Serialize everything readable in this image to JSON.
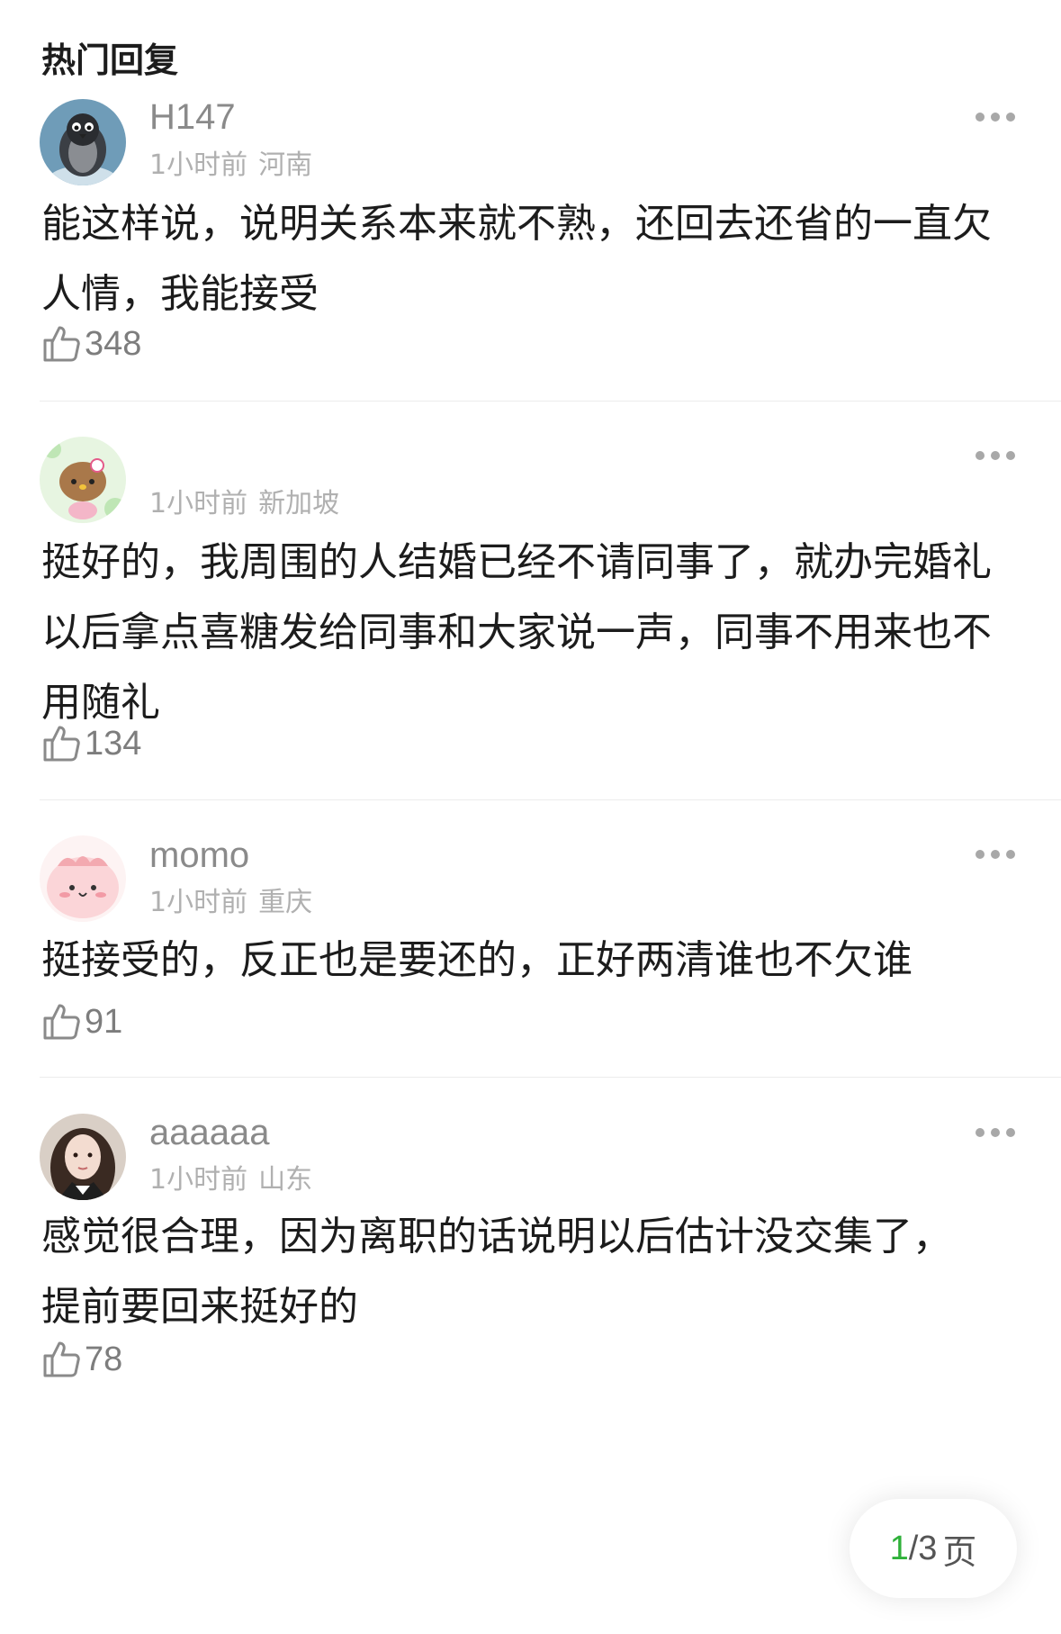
{
  "header": {
    "title": "热门回复"
  },
  "comments": [
    {
      "username": "H147",
      "time": "1小时前",
      "location": "河南",
      "text": "能这样说，说明关系本来就不熟，还回去还省的一直欠人情，我能接受",
      "likes": "348"
    },
    {
      "username": "",
      "time": "1小时前",
      "location": "新加坡",
      "text": "挺好的，我周围的人结婚已经不请同事了，就办完婚礼以后拿点喜糖发给同事和大家说一声，同事不用来也不用随礼",
      "likes": "134"
    },
    {
      "username": "momo",
      "time": "1小时前",
      "location": "重庆",
      "text": "挺接受的，反正也是要还的，正好两清谁也不欠谁",
      "likes": "91"
    },
    {
      "username": "aaaaaa",
      "time": "1小时前",
      "location": "山东",
      "text": "感觉很合理，因为离职的话说明以后估计没交集了，提前要回来挺好的",
      "likes": "78"
    }
  ],
  "pager": {
    "current": "1",
    "total": "/3",
    "unit": "页"
  },
  "colors": {
    "accent": "#2fb13a",
    "username": "#8a8a8a",
    "meta": "#b0b0b0",
    "text": "#1c1c1c"
  },
  "icons": {
    "like": "thumbs-up-icon",
    "more": "more-dots-icon"
  }
}
